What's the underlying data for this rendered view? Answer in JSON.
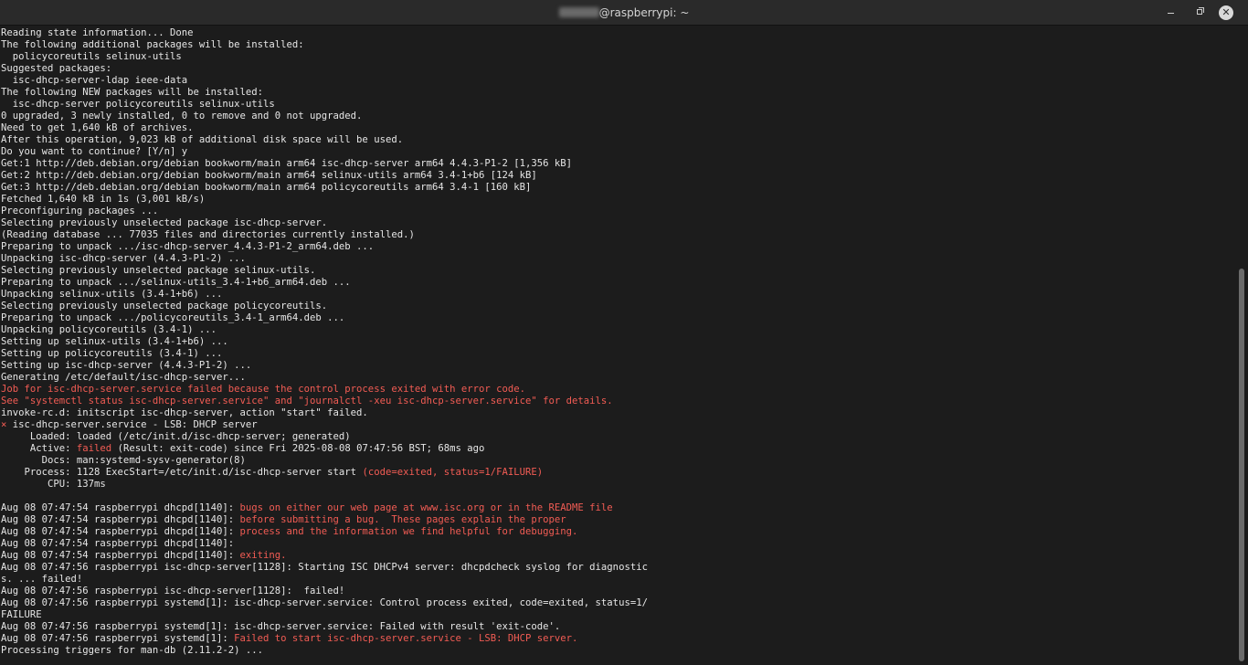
{
  "window": {
    "title_host": "@raspberrypi: ~",
    "controls": {
      "minimize": "minimize-icon",
      "maximize": "maximize-icon",
      "close": "close-icon"
    }
  },
  "colors": {
    "background": "#1c1c1c",
    "text": "#e6e6e6",
    "error": "#f25c54"
  },
  "terminal": {
    "lines": [
      {
        "segs": [
          {
            "t": "Reading state information... Done"
          }
        ]
      },
      {
        "segs": [
          {
            "t": "The following additional packages will be installed:"
          }
        ]
      },
      {
        "segs": [
          {
            "t": "  policycoreutils selinux-utils"
          }
        ]
      },
      {
        "segs": [
          {
            "t": "Suggested packages:"
          }
        ]
      },
      {
        "segs": [
          {
            "t": "  isc-dhcp-server-ldap ieee-data"
          }
        ]
      },
      {
        "segs": [
          {
            "t": "The following NEW packages will be installed:"
          }
        ]
      },
      {
        "segs": [
          {
            "t": "  isc-dhcp-server policycoreutils selinux-utils"
          }
        ]
      },
      {
        "segs": [
          {
            "t": "0 upgraded, 3 newly installed, 0 to remove and 0 not upgraded."
          }
        ]
      },
      {
        "segs": [
          {
            "t": "Need to get 1,640 kB of archives."
          }
        ]
      },
      {
        "segs": [
          {
            "t": "After this operation, 9,023 kB of additional disk space will be used."
          }
        ]
      },
      {
        "segs": [
          {
            "t": "Do you want to continue? [Y/n] y"
          }
        ]
      },
      {
        "segs": [
          {
            "t": "Get:1 http://deb.debian.org/debian bookworm/main arm64 isc-dhcp-server arm64 4.4.3-P1-2 [1,356 kB]"
          }
        ]
      },
      {
        "segs": [
          {
            "t": "Get:2 http://deb.debian.org/debian bookworm/main arm64 selinux-utils arm64 3.4-1+b6 [124 kB]"
          }
        ]
      },
      {
        "segs": [
          {
            "t": "Get:3 http://deb.debian.org/debian bookworm/main arm64 policycoreutils arm64 3.4-1 [160 kB]"
          }
        ]
      },
      {
        "segs": [
          {
            "t": "Fetched 1,640 kB in 1s (3,001 kB/s)"
          }
        ]
      },
      {
        "segs": [
          {
            "t": "Preconfiguring packages ..."
          }
        ]
      },
      {
        "segs": [
          {
            "t": "Selecting previously unselected package isc-dhcp-server."
          }
        ]
      },
      {
        "segs": [
          {
            "t": "(Reading database ... 77035 files and directories currently installed.)"
          }
        ]
      },
      {
        "segs": [
          {
            "t": "Preparing to unpack .../isc-dhcp-server_4.4.3-P1-2_arm64.deb ..."
          }
        ]
      },
      {
        "segs": [
          {
            "t": "Unpacking isc-dhcp-server (4.4.3-P1-2) ..."
          }
        ]
      },
      {
        "segs": [
          {
            "t": "Selecting previously unselected package selinux-utils."
          }
        ]
      },
      {
        "segs": [
          {
            "t": "Preparing to unpack .../selinux-utils_3.4-1+b6_arm64.deb ..."
          }
        ]
      },
      {
        "segs": [
          {
            "t": "Unpacking selinux-utils (3.4-1+b6) ..."
          }
        ]
      },
      {
        "segs": [
          {
            "t": "Selecting previously unselected package policycoreutils."
          }
        ]
      },
      {
        "segs": [
          {
            "t": "Preparing to unpack .../policycoreutils_3.4-1_arm64.deb ..."
          }
        ]
      },
      {
        "segs": [
          {
            "t": "Unpacking policycoreutils (3.4-1) ..."
          }
        ]
      },
      {
        "segs": [
          {
            "t": "Setting up selinux-utils (3.4-1+b6) ..."
          }
        ]
      },
      {
        "segs": [
          {
            "t": "Setting up policycoreutils (3.4-1) ..."
          }
        ]
      },
      {
        "segs": [
          {
            "t": "Setting up isc-dhcp-server (4.4.3-P1-2) ..."
          }
        ]
      },
      {
        "segs": [
          {
            "t": "Generating /etc/default/isc-dhcp-server..."
          }
        ]
      },
      {
        "segs": [
          {
            "t": "Job for isc-dhcp-server.service failed because the control process exited with error code.",
            "c": "red"
          }
        ]
      },
      {
        "segs": [
          {
            "t": "See \"systemctl status isc-dhcp-server.service\" and \"journalctl -xeu isc-dhcp-server.service\" for details.",
            "c": "red"
          }
        ]
      },
      {
        "segs": [
          {
            "t": "invoke-rc.d: initscript isc-dhcp-server, action \"start\" failed."
          }
        ]
      },
      {
        "segs": [
          {
            "t": "×",
            "c": "red"
          },
          {
            "t": " isc-dhcp-server.service - LSB: DHCP server"
          }
        ]
      },
      {
        "segs": [
          {
            "t": "     Loaded: loaded (/etc/init.d/isc-dhcp-server; generated)"
          }
        ]
      },
      {
        "segs": [
          {
            "t": "     Active: "
          },
          {
            "t": "failed",
            "c": "red"
          },
          {
            "t": " (Result: exit-code) since Fri 2025-08-08 07:47:56 BST; 68ms ago"
          }
        ]
      },
      {
        "segs": [
          {
            "t": "       Docs: man:systemd-sysv-generator(8)"
          }
        ]
      },
      {
        "segs": [
          {
            "t": "    Process: 1128 ExecStart=/etc/init.d/isc-dhcp-server start "
          },
          {
            "t": "(code=exited, status=1/FAILURE)",
            "c": "red"
          }
        ]
      },
      {
        "segs": [
          {
            "t": "        CPU: 137ms"
          }
        ]
      },
      {
        "segs": [
          {
            "t": ""
          }
        ]
      },
      {
        "segs": [
          {
            "t": "Aug 08 07:47:54 raspberrypi dhcpd[1140]: "
          },
          {
            "t": "bugs on either our web page at www.isc.org or in the README file",
            "c": "red"
          }
        ]
      },
      {
        "segs": [
          {
            "t": "Aug 08 07:47:54 raspberrypi dhcpd[1140]: "
          },
          {
            "t": "before submitting a bug.  These pages explain the proper",
            "c": "red"
          }
        ]
      },
      {
        "segs": [
          {
            "t": "Aug 08 07:47:54 raspberrypi dhcpd[1140]: "
          },
          {
            "t": "process and the information we find helpful for debugging.",
            "c": "red"
          }
        ]
      },
      {
        "segs": [
          {
            "t": "Aug 08 07:47:54 raspberrypi dhcpd[1140]:"
          }
        ]
      },
      {
        "segs": [
          {
            "t": "Aug 08 07:47:54 raspberrypi dhcpd[1140]: "
          },
          {
            "t": "exiting.",
            "c": "red"
          }
        ]
      },
      {
        "segs": [
          {
            "t": "Aug 08 07:47:56 raspberrypi isc-dhcp-server[1128]: Starting ISC DHCPv4 server: dhcpdcheck syslog for diagnostic"
          }
        ]
      },
      {
        "segs": [
          {
            "t": "s. ... failed!"
          }
        ]
      },
      {
        "segs": [
          {
            "t": "Aug 08 07:47:56 raspberrypi isc-dhcp-server[1128]:  failed!"
          }
        ]
      },
      {
        "segs": [
          {
            "t": "Aug 08 07:47:56 raspberrypi systemd[1]: isc-dhcp-server.service: Control process exited, code=exited, status=1/"
          }
        ]
      },
      {
        "segs": [
          {
            "t": "FAILURE"
          }
        ]
      },
      {
        "segs": [
          {
            "t": "Aug 08 07:47:56 raspberrypi systemd[1]: isc-dhcp-server.service: Failed with result 'exit-code'."
          }
        ]
      },
      {
        "segs": [
          {
            "t": "Aug 08 07:47:56 raspberrypi systemd[1]: "
          },
          {
            "t": "Failed to start isc-dhcp-server.service - LSB: DHCP server.",
            "c": "red"
          }
        ]
      },
      {
        "segs": [
          {
            "t": "Processing triggers for man-db (2.11.2-2) ..."
          }
        ]
      }
    ]
  }
}
